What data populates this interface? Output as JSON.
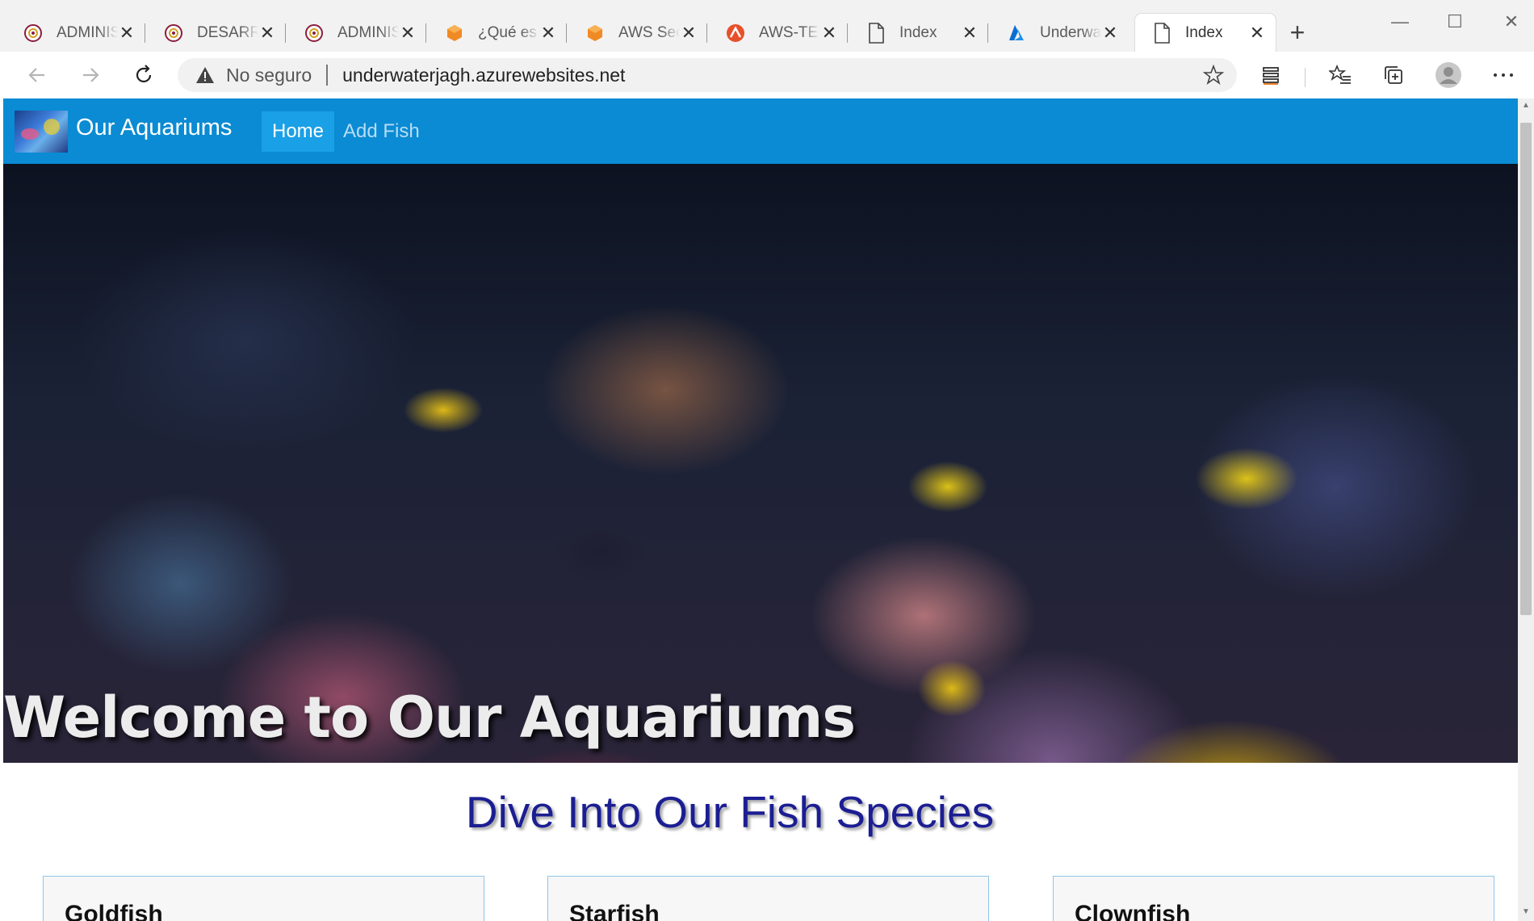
{
  "browser": {
    "tabs": [
      {
        "title": "ADMINISTRACIÓN",
        "icon": "org-logo-icon"
      },
      {
        "title": "DESARROLLO",
        "icon": "org-logo-icon"
      },
      {
        "title": "ADMINISTRACIÓN",
        "icon": "org-logo-icon"
      },
      {
        "title": "¿Qué es DevOps?",
        "icon": "aws-box-icon"
      },
      {
        "title": "AWS Security",
        "icon": "aws-box-icon"
      },
      {
        "title": "AWS-TE - ",
        "icon": "orange-circle-icon"
      },
      {
        "title": "Index",
        "icon": "page-icon"
      },
      {
        "title": "Underwater",
        "icon": "azure-icon"
      },
      {
        "title": "Index",
        "icon": "page-icon"
      }
    ],
    "close_glyph": "✕",
    "new_tab_glyph": "+",
    "address": {
      "security_label": "No seguro",
      "url": "underwaterjagh.azurewebsites.net"
    },
    "window_controls": {
      "minimize": "—",
      "maximize": "☐",
      "close": "✕"
    }
  },
  "site": {
    "brand": "Our Aquariums",
    "nav": [
      {
        "label": "Home",
        "active": true
      },
      {
        "label": "Add Fish",
        "active": false
      }
    ],
    "hero_title": "Welcome to Our Aquariums",
    "section_title": "Dive Into Our Fish Species",
    "cards": [
      {
        "title": "Goldfish"
      },
      {
        "title": "Starfish"
      },
      {
        "title": "Clownfish"
      }
    ]
  },
  "colors": {
    "navbar": "#0a8bd3",
    "nav_active": "#1aa0e6",
    "section_title": "#1b1e92",
    "card_border": "#8cc5ea"
  }
}
